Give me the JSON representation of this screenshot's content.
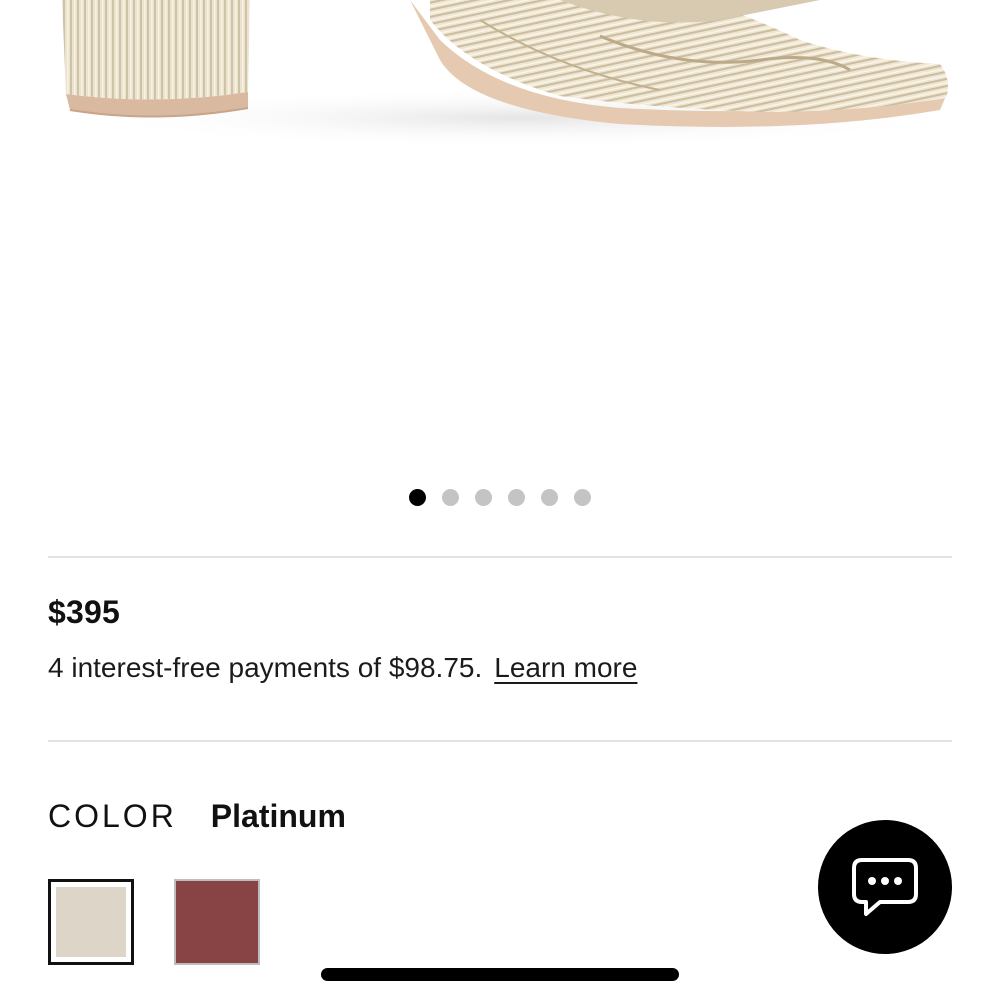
{
  "product": {
    "price": "$395",
    "installment_text": "4 interest-free payments of $98.75.",
    "learn_more": "Learn more"
  },
  "carousel": {
    "count": 6,
    "active_index": 0
  },
  "color": {
    "label": "COLOR",
    "selected": "Platinum",
    "swatches": [
      {
        "color": "#dcd5c8",
        "selected": true
      },
      {
        "color": "#884444",
        "selected": false
      }
    ]
  },
  "icons": {
    "chat": "chat-bubble-icon"
  }
}
